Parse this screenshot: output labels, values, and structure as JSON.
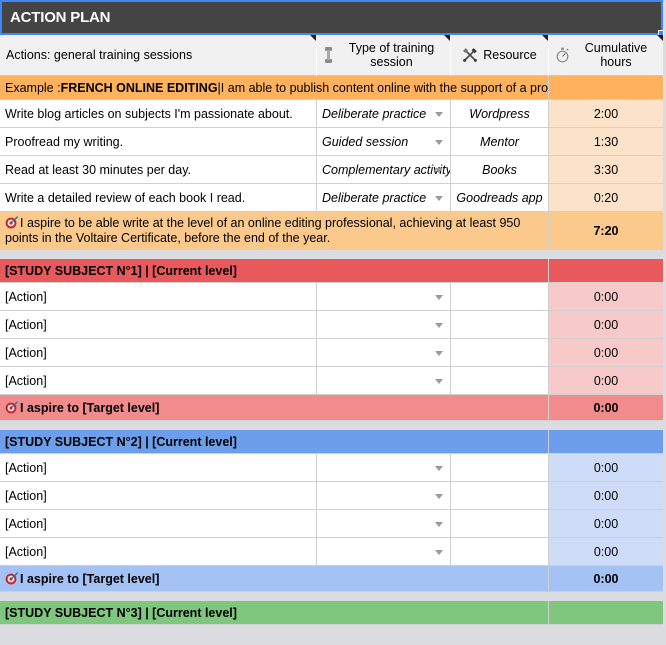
{
  "title": {
    "text": "ACTION PLAN"
  },
  "columns": {
    "actions": {
      "label": "Actions: general training sessions"
    },
    "type": {
      "label": "Type of training session",
      "icon": "dumbbell-icon"
    },
    "resource": {
      "label": "Resource",
      "icon": "tools-icon"
    },
    "hours": {
      "label": "Cumulative hours",
      "icon": "stopwatch-icon"
    }
  },
  "example": {
    "prefix": "Example : ",
    "subject": "FRENCH ONLINE EDITING",
    "separator": " | ",
    "level": "I am able to publish content online with the support of a proofreader.",
    "rows": [
      {
        "action": "Write blog articles on subjects I'm passionate about.",
        "type": "Deliberate practice",
        "resource": "Wordpress",
        "hours": "2:00"
      },
      {
        "action": "Proofread my writing.",
        "type": "Guided session",
        "resource": "Mentor",
        "hours": "1:30"
      },
      {
        "action": "Read at least 30 minutes per day.",
        "type": "Complementary activity",
        "resource": "Books",
        "hours": "3:30"
      },
      {
        "action": "Write a detailed review of each book I read.",
        "type": "Deliberate practice",
        "resource": "Goodreads app",
        "hours": "0:20"
      }
    ],
    "aspire": {
      "icon": "target-icon",
      "text": "I aspire to be able write at the level of an online editing professional, achieving at least 950 points in the Voltaire Certificate, before the end of the year.",
      "hours": "7:20"
    }
  },
  "subject1": {
    "header": "[STUDY SUBJECT N°1] | [Current level]",
    "rows": [
      {
        "action": "[Action]",
        "type": "",
        "resource": "",
        "hours": "0:00"
      },
      {
        "action": "[Action]",
        "type": "",
        "resource": "",
        "hours": "0:00"
      },
      {
        "action": "[Action]",
        "type": "",
        "resource": "",
        "hours": "0:00"
      },
      {
        "action": "[Action]",
        "type": "",
        "resource": "",
        "hours": "0:00"
      }
    ],
    "aspire": {
      "icon": "target-icon",
      "text": "I aspire to [Target level]",
      "hours": "0:00"
    }
  },
  "subject2": {
    "header": "[STUDY SUBJECT N°2] | [Current level]",
    "rows": [
      {
        "action": "[Action]",
        "type": "",
        "resource": "",
        "hours": "0:00"
      },
      {
        "action": "[Action]",
        "type": "",
        "resource": "",
        "hours": "0:00"
      },
      {
        "action": "[Action]",
        "type": "",
        "resource": "",
        "hours": "0:00"
      },
      {
        "action": "[Action]",
        "type": "",
        "resource": "",
        "hours": "0:00"
      }
    ],
    "aspire": {
      "icon": "target-icon",
      "text": "I aspire to [Target level]",
      "hours": "0:00"
    }
  },
  "subject3": {
    "header": "[STUDY SUBJECT N°3] | [Current level]"
  },
  "colors": {
    "title_bg": "#444444",
    "selection": "#4285f4",
    "orange": "#feb25e",
    "orange_light": "#fbc98c",
    "peach": "#fce2c8",
    "red": "#e8595b",
    "red_light": "#f28b8c",
    "pink": "#f8c9c9",
    "blue": "#6d9eeb",
    "blue_light": "#a4c2f4",
    "blue_pale": "#cfdcf8",
    "green": "#7fc67f",
    "grid": "#d0d0d0",
    "header_bg": "#f1f1f1",
    "gap_bg": "#dadce0"
  }
}
